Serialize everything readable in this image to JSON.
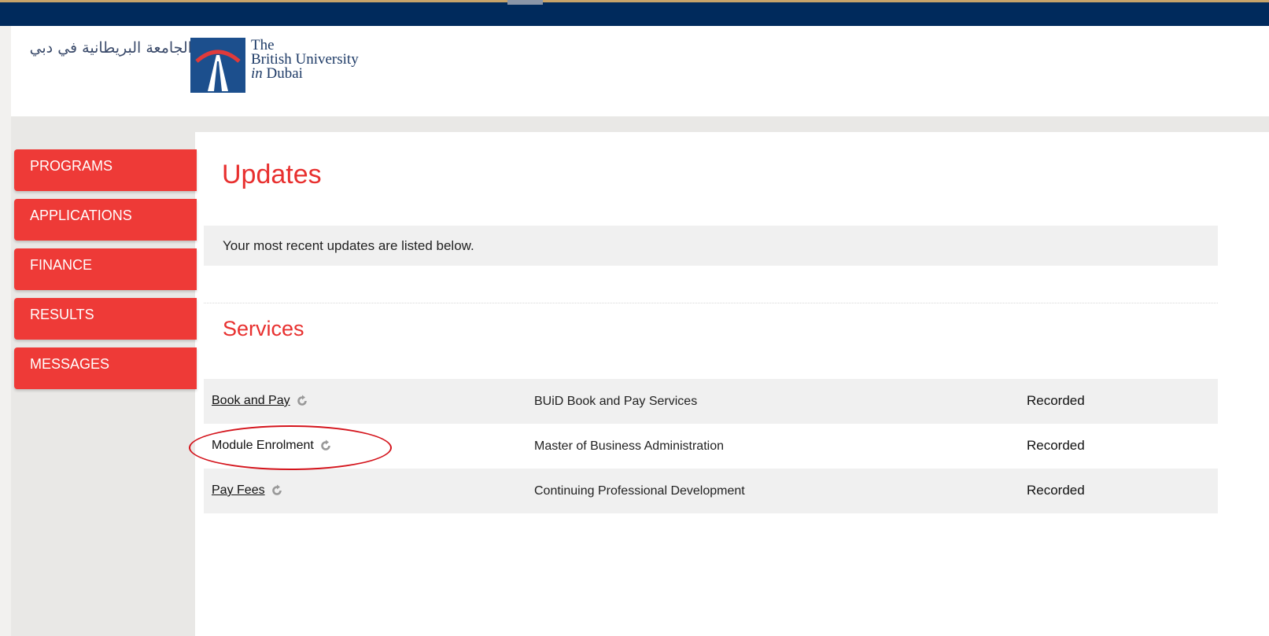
{
  "header": {
    "logo_arabic": "الجامعة البريطانية في دبي",
    "logo_line1": "The",
    "logo_line2": "British University",
    "logo_line3_in": "in",
    "logo_line3": " Dubai"
  },
  "sidebar": {
    "items": [
      {
        "label": "PROGRAMS"
      },
      {
        "label": "APPLICATIONS"
      },
      {
        "label": "FINANCE"
      },
      {
        "label": "RESULTS"
      },
      {
        "label": "MESSAGES"
      }
    ]
  },
  "main": {
    "title": "Updates",
    "info": "Your most recent updates are listed below.",
    "services_title": "Services",
    "services": [
      {
        "name": "Book and Pay",
        "linked": true,
        "description": "BUiD Book and Pay Services",
        "status": "Recorded"
      },
      {
        "name": "Module Enrolment",
        "linked": false,
        "description": "Master of Business Administration",
        "status": "Recorded"
      },
      {
        "name": "Pay Fees",
        "linked": true,
        "description": "Continuing Professional Development",
        "status": "Recorded"
      }
    ]
  },
  "colors": {
    "nav_red": "#ee3a37",
    "title_red": "#e8302f",
    "top_navy": "#002a5c",
    "circle_red": "#d4141c"
  },
  "icons": {
    "refresh": "refresh-icon"
  }
}
